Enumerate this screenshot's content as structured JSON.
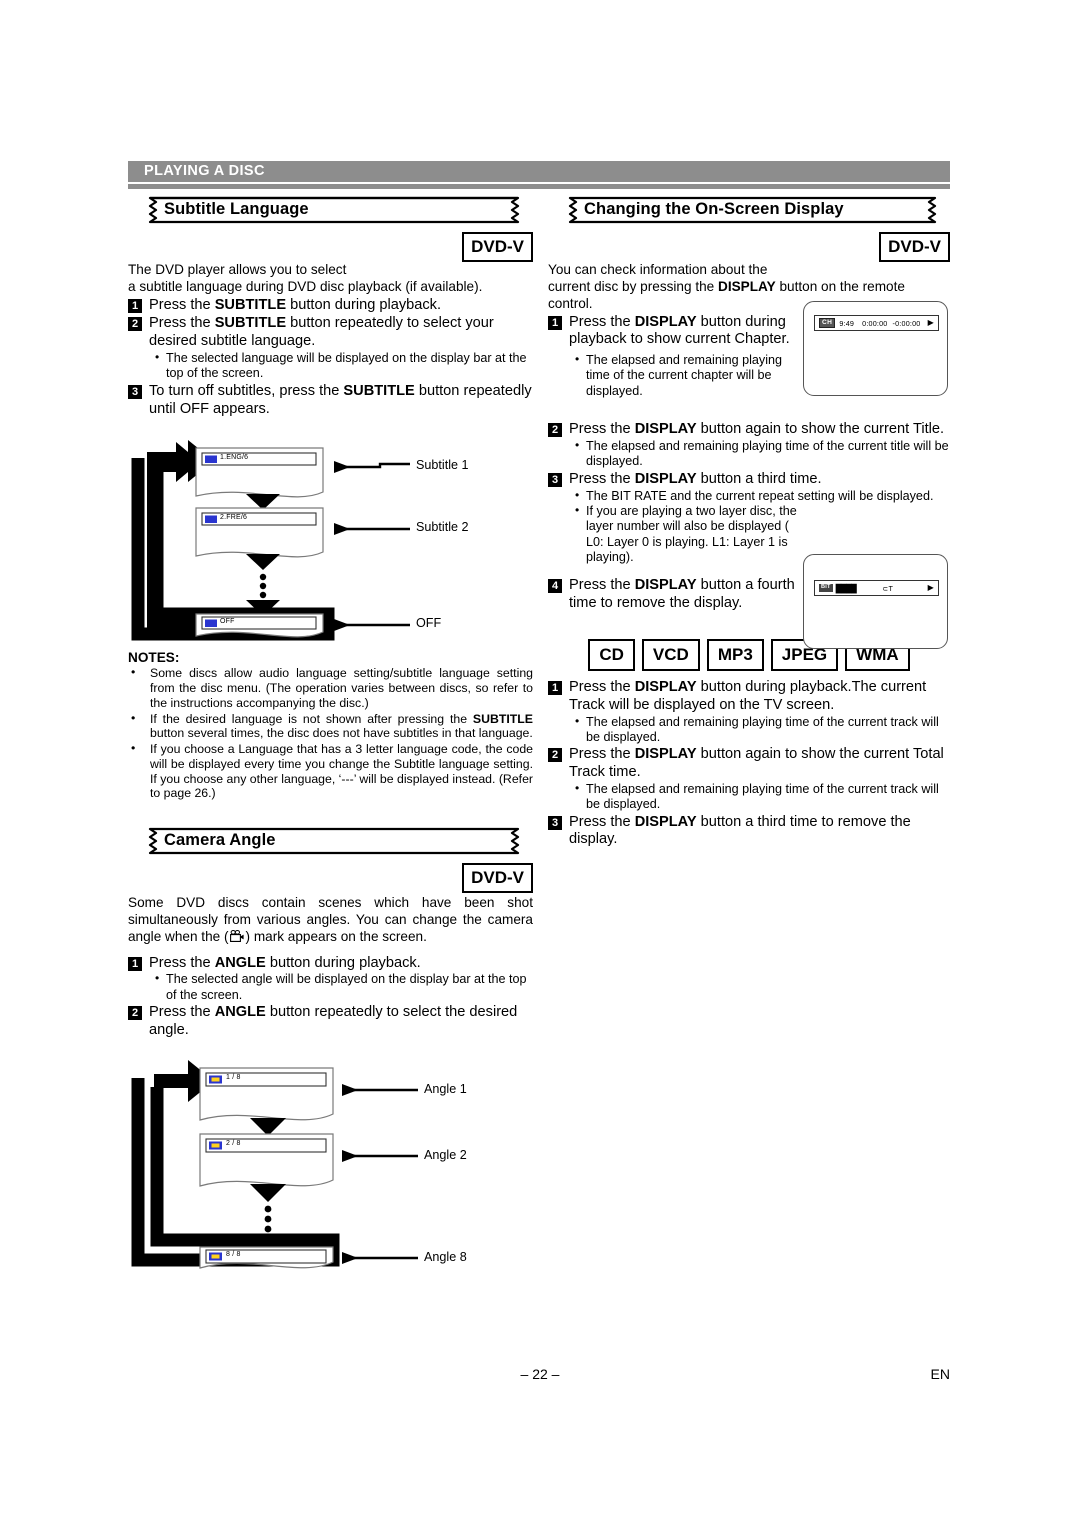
{
  "document": {
    "section_header": "PLAYING A DISC",
    "footer_page": "– 22 –",
    "footer_language": "EN"
  },
  "left_column": {
    "subtitle_section": {
      "title": "Subtitle Language",
      "badge": "DVD-V",
      "intro_line1": "The DVD player allows you to select",
      "intro_line2": "a subtitle language during DVD disc playback (if available).",
      "steps": [
        {
          "num": "1",
          "text_plain": "Press the SUBTITLE button during playback."
        },
        {
          "num": "2",
          "text_plain": "Press the SUBTITLE button repeatedly to select your desired subtitle language."
        },
        {
          "num": "3",
          "text_plain": "To turn off subtitles, press the SUBTITLE button repeatedly until OFF appears."
        }
      ],
      "bullet_after_step2": "The selected language will be displayed on the display bar at the top of the screen.",
      "diagram": {
        "screens": [
          {
            "osd": "1.ENG/6",
            "label": "Subtitle 1"
          },
          {
            "osd": "2.FRE/6",
            "label": "Subtitle 2"
          },
          {
            "osd": "OFF",
            "label": "OFF"
          }
        ]
      }
    },
    "notes": {
      "title": "NOTES:",
      "items": [
        "Some discs allow audio language setting/subtitle language setting from the disc menu. (The operation varies between discs, so refer to the instructions accompanying the disc.)",
        "If the desired language is not shown after pressing the SUBTITLE button several times, the disc does not have subtitles in that language.",
        "If you choose a Language that has a 3 letter language code, the code will be displayed every time you change the Subtitle language setting. If you choose any other language, ‘---’ will be displayed instead. (Refer to page 26.)"
      ]
    },
    "camera_section": {
      "title": "Camera Angle",
      "badge": "DVD-V",
      "intro_part1": "Some DVD discs contain scenes which have been shot simultaneously from various angles. You can change the camera angle when the (",
      "intro_part2": ") mark appears on the screen.",
      "steps": [
        {
          "num": "1",
          "text_plain": "Press the ANGLE button during playback."
        },
        {
          "num": "2",
          "text_plain": "Press the ANGLE button repeatedly to select the desired angle."
        }
      ],
      "bullet_after_step1": "The selected angle will be displayed on the display bar at the top of the screen.",
      "diagram": {
        "screens": [
          {
            "osd": "1 / 8",
            "label": "Angle 1"
          },
          {
            "osd": "2 / 8",
            "label": "Angle 2"
          },
          {
            "osd": "8 / 8",
            "label": "Angle 8"
          }
        ]
      }
    }
  },
  "right_column": {
    "osd_section": {
      "title": "Changing the On-Screen Display",
      "badge": "DVD-V",
      "intro_line1": "You can check information about the",
      "intro_line2": "current disc by pressing the DISPLAY button on the remote",
      "intro_line3": "control.",
      "steps": [
        {
          "num": "1",
          "text_plain": "Press the DISPLAY button during playback to show current Chapter."
        },
        {
          "num": "2",
          "text_plain": "Press the DISPLAY button again to show the current Title."
        },
        {
          "num": "3",
          "text_plain": "Press the DISPLAY button a third time."
        },
        {
          "num": "4",
          "text_plain": "Press the DISPLAY button a fourth time to remove the display."
        }
      ],
      "bullet_step1": "The elapsed and remaining playing time of the current chapter will be displayed.",
      "bullet_step2": "The elapsed and remaining playing time of the current title will be displayed.",
      "bullet_step3a": "The BIT RATE and the current repeat setting will be displayed.",
      "bullet_step3b": "If you are playing a two layer disc, the layer number will also be displayed ( L0: Layer 0 is playing.  L1: Layer 1 is playing).",
      "tv_screen_1": {
        "chip": "CH",
        "chapter": "9:49",
        "elapsed": "0:00:00",
        "remaining": "-0:00:00",
        "play_icon": "▶"
      },
      "tv_screen_2": {
        "chip": "BIT",
        "bars": "████",
        "repeat": "⊂T",
        "play_icon": "▶"
      }
    },
    "disc_formats_section": {
      "badges": [
        "CD",
        "VCD",
        "MP3",
        "JPEG",
        "WMA"
      ],
      "steps": [
        {
          "num": "1",
          "text_plain": "Press the DISPLAY button during playback.The current Track will be displayed on the TV screen."
        },
        {
          "num": "2",
          "text_plain": "Press the DISPLAY button again to show the current Total Track time."
        },
        {
          "num": "3",
          "text_plain": "Press the DISPLAY button a third time to remove the display."
        }
      ],
      "bullet_step1": "The elapsed and remaining playing time of the current track will be displayed.",
      "bullet_step2": "The elapsed and remaining playing time of the current track will be displayed."
    }
  }
}
